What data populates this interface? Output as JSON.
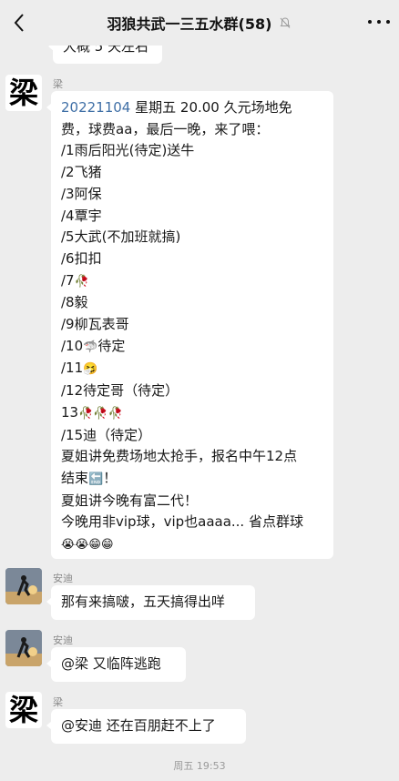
{
  "header": {
    "title": "羽狼共武一三五水群(58)"
  },
  "messages": {
    "prev_partial": {
      "text": "大概 5 天左右"
    },
    "m1": {
      "sender": "梁",
      "avatar_char": "梁",
      "date_text": "20221104",
      "lines": [
        " 星期五 20.00 久元场地免",
        "费，球费aa，最后一晚，来了喂：",
        "/1雨后阳光(待定)送牛",
        "/2飞猪",
        "/3阿保",
        "/4覃宇",
        "/5大武(不加班就搞)",
        "/6扣扣",
        "/7",
        "/8毅",
        "/9柳瓦表哥",
        "/10",
        "待定",
        "/11",
        "/12待定哥（待定）",
        "13",
        "/15迪（待定）",
        "夏姐讲免费场地太抢手，报名中午12点",
        "结束",
        "！",
        "夏姐讲今晚有富二代！",
        "今晚用非vip球，vip也aaaa... 省点群球"
      ],
      "emojis": {
        "rose": "🥀",
        "shark": "🦈",
        "sneeze": "🤧",
        "end": "🔚",
        "cry": "😭",
        "grin": "😁"
      }
    },
    "m2": {
      "sender": "安迪",
      "text": "那有来搞啵，五天搞得出咩"
    },
    "m3": {
      "sender": "安迪",
      "text": "@梁  又临阵逃跑"
    },
    "m4": {
      "sender": "梁",
      "avatar_char": "梁",
      "text": "@安迪  还在百朋赶不上了"
    }
  },
  "timestamp": "周五 19:53",
  "colors": {
    "background": "#ededed",
    "bubble": "#ffffff",
    "link": "#3f6fa6"
  },
  "icons": [
    "back-arrow-icon",
    "mute-bell-icon",
    "more-dots-icon"
  ]
}
